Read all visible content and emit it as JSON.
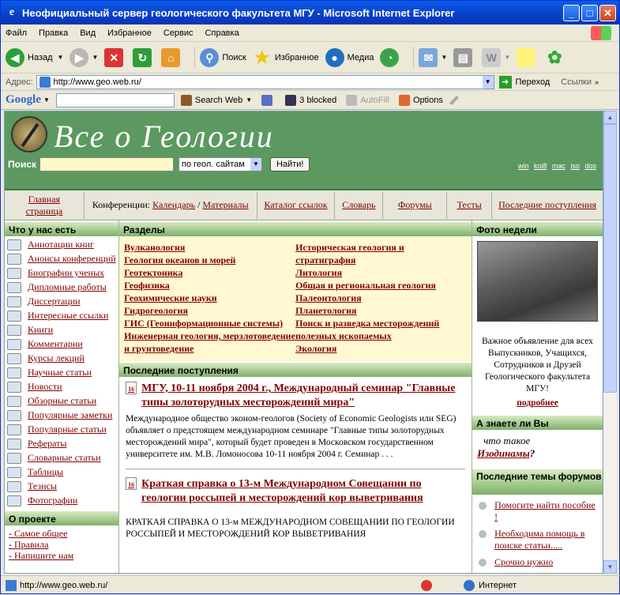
{
  "window": {
    "title": "Неофициальный сервер геологического факультета МГУ - Microsoft Internet Explorer"
  },
  "menu": [
    "Файл",
    "Правка",
    "Вид",
    "Избранное",
    "Сервис",
    "Справка"
  ],
  "toolbar": {
    "back": "Назад",
    "search": "Поиск",
    "favorites": "Избранное",
    "media": "Медиа"
  },
  "address": {
    "label": "Адрес:",
    "url": "http://www.geo.web.ru/",
    "go": "Переход",
    "links": "Ссылки"
  },
  "google": {
    "logo": "Google",
    "search_web": "Search Web",
    "blocked": "3 blocked",
    "autofill": "AutoFill",
    "options": "Options"
  },
  "site": {
    "title": "Все о Геологии",
    "search_label": "Поиск",
    "search_scope": "по геол. сайтам",
    "search_button": "Найти!",
    "encodings": [
      "win",
      "koi8",
      "mac",
      "iso",
      "dos"
    ]
  },
  "nav": {
    "home": "Главная страница",
    "conf_prefix": "Конференции:",
    "conf_calendar": "Календарь",
    "conf_sep": "/",
    "conf_materials": "Материалы",
    "catalog": "Каталог ссылок",
    "dictionary": "Словарь",
    "forums": "Форумы",
    "tests": "Тесты",
    "latest": "Последние поступления"
  },
  "left": {
    "heading": "Что у нас есть",
    "items": [
      "Аннотации книг",
      "Анонсы конференций",
      "Биографии ученых",
      "Дипломные работы",
      "Диссертации",
      "Интересные ссылки",
      "Книги",
      "Комментарии",
      "Курсы лекций",
      "Научные статьи",
      "Новости",
      "Обзорные статьи",
      "Популярные заметки",
      "Популярные статьи",
      "Рефераты",
      "Словарные статьи",
      "Таблицы",
      "Тезисы",
      "Фотографии"
    ],
    "about_heading": "О проекте",
    "about_items": [
      "Самое общее",
      "Правила",
      "Напишите нам"
    ]
  },
  "sections": {
    "heading": "Разделы",
    "col1": [
      "Вулканология",
      "Геология океанов и морей",
      "Геотектоника",
      "Геофизика",
      "Геохимические науки",
      "Гидрогеология",
      "ГИС (Геоинформационные системы)",
      "Инженерная геология, мерзлотоведение и грунтоведение"
    ],
    "col2": [
      "Историческая геология и стратиграфия",
      "Литология",
      "Общая и региональная геология",
      "Палеонтология",
      "Планетология",
      "Поиск и разведка месторождений полезных ископаемых",
      "Экология"
    ]
  },
  "news": {
    "heading": "Последние поступления",
    "items": [
      {
        "title": "МГУ, 10-11 ноября 2004 г., Международный семинар \"Главные типы золоторудных месторождений мира\"",
        "body": "Международное общество эконом-геологов (Society of Economic Geologists или SEG) объявляет о предстоящем международном семинаре \"Главные типы золоторудных месторождений мира\", который будет проведен в Московском государственном университете им. М.В. Ломоносова 10-11 ноября 2004 г. Семинар . . ."
      },
      {
        "title": "Краткая справка о 13-м Международном Совещании по геологии россыпей и месторождений кор выветривания",
        "body": "КРАТКАЯ СПРАВКА О 13-м МЕЖДУНАРОДНОМ СОВЕЩАНИИ ПО ГЕОЛОГИИ РОССЫПЕЙ И МЕСТОРОЖДЕНИЙ КОР ВЫВЕТРИВАНИЯ"
      }
    ]
  },
  "right": {
    "photo_heading": "Фото недели",
    "photo_caption": "Важное объявление для всех Выпускников, Учащихся, Сотрудников и Друзей Геологического факультета МГУ!",
    "more": "подробнее",
    "know_heading": "А знаете ли Вы",
    "know_q": "что такое",
    "know_term": "Изодинамы",
    "know_mark": "?",
    "forum_heading": "Последние темы форумов",
    "forum_items": [
      "Помогите найти пособие !",
      "Необходима помощь в поиске статьи.....",
      "Срочно нужно"
    ]
  },
  "status": {
    "url": "http://www.geo.web.ru/",
    "zone": "Интернет"
  }
}
